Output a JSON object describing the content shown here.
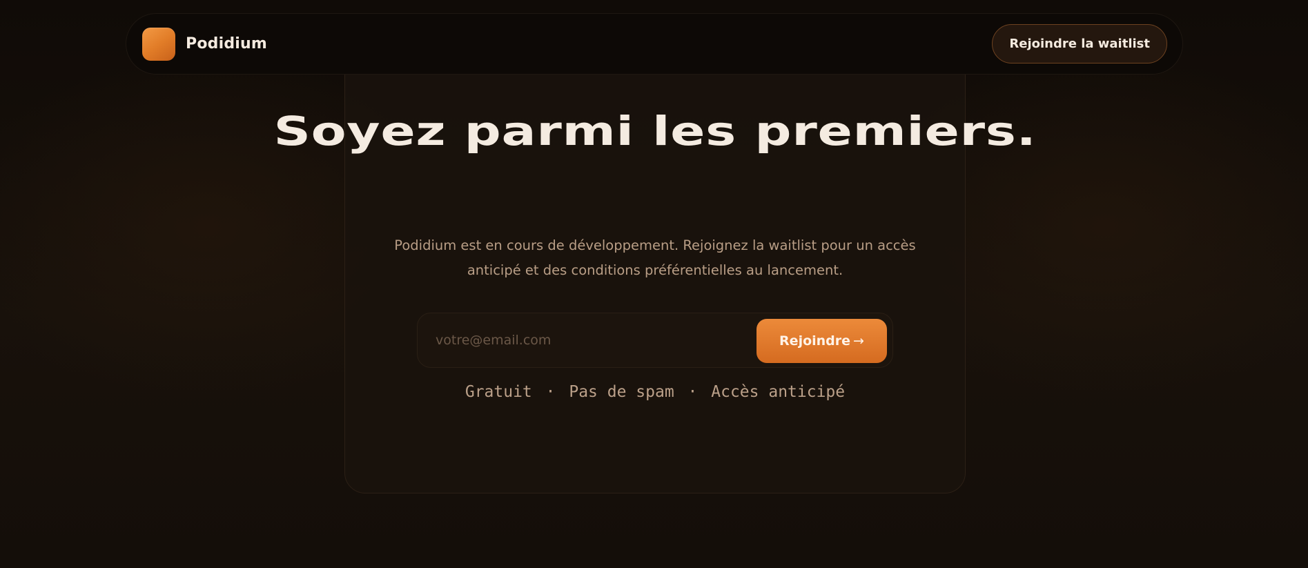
{
  "nav": {
    "brand_name": "Podidium",
    "cta_label": "Rejoindre la waitlist"
  },
  "hero": {
    "title": "Soyez parmi les premiers.",
    "subtitle": "Podidium est en cours de développement. Rejoignez la waitlist pour un accès anticipé et des conditions préférentielles au lancement."
  },
  "form": {
    "email_value": "",
    "email_placeholder": "votre@email.com",
    "submit_label": "Rejoindre",
    "submit_arrow": "→"
  },
  "tagline": {
    "items": [
      "Gratuit",
      "Pas de spam",
      "Accès anticipé"
    ],
    "separator": "·"
  },
  "colors": {
    "background": "#150f0a",
    "accent": "#e27d28",
    "text_primary": "#f4ebe1",
    "text_muted": "#b99e86"
  }
}
